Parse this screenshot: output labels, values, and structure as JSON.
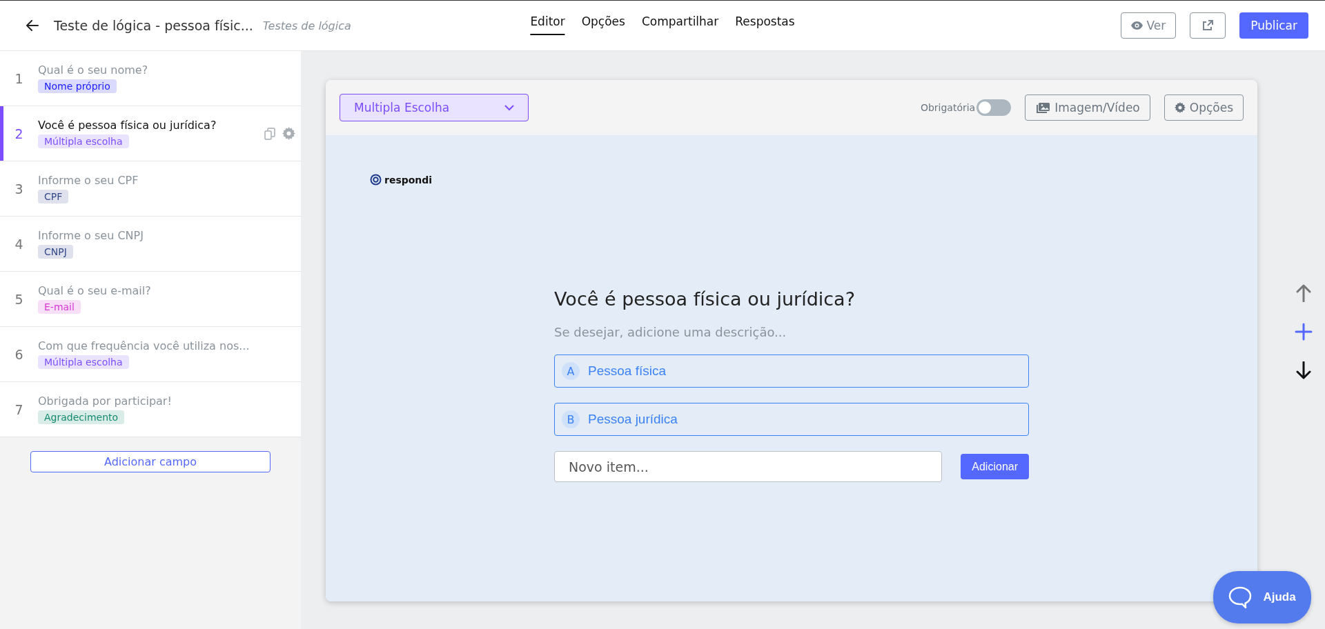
{
  "header": {
    "title": "Teste de lógica - pessoa físic...",
    "folder": "Testes de lógica",
    "tabs": [
      {
        "label": "Editor",
        "selected": true
      },
      {
        "label": "Opções",
        "selected": false
      },
      {
        "label": "Compartilhar",
        "selected": false
      },
      {
        "label": "Respostas",
        "selected": false
      }
    ],
    "view_button": "Ver",
    "publish_button": "Publicar"
  },
  "sidebar": {
    "items": [
      {
        "number": "1",
        "title": "Qual é o seu nome?",
        "tag": "Nome próprio",
        "color": "#1a1aff",
        "selected": false
      },
      {
        "number": "2",
        "title": "Você é pessoa física ou jurídica?",
        "tag": "Múltipla escolha",
        "color": "#7c4dff",
        "selected": true
      },
      {
        "number": "3",
        "title": "Informe o seu CPF",
        "tag": "CPF",
        "color": "#34488a",
        "selected": false
      },
      {
        "number": "4",
        "title": "Informe o seu CNPJ",
        "tag": "CNPJ",
        "color": "#34488a",
        "selected": false
      },
      {
        "number": "5",
        "title": "Qual é o seu e-mail?",
        "tag": "E-mail",
        "color": "#d63ad6",
        "selected": false
      },
      {
        "number": "6",
        "title": "Com que frequência você utiliza nos...",
        "tag": "Múltipla escolha",
        "color": "#7c4dff",
        "selected": false
      },
      {
        "number": "7",
        "title": "Obrigada por participar!",
        "tag": "Agradecimento",
        "color": "#138a70",
        "selected": false
      }
    ],
    "add_button": "Adicionar campo"
  },
  "editor": {
    "type_select": "Multipla Escolha",
    "required": {
      "label": "Obrigatória",
      "on": false
    },
    "media_button": "Imagem/Vídeo",
    "options_button": "Opções",
    "logo": "respondi",
    "question": "Você é pessoa física ou jurídica?",
    "description_placeholder": "Se desejar, adicione uma descrição...",
    "choices": [
      {
        "letter": "A",
        "label": "Pessoa física"
      },
      {
        "letter": "B",
        "label": "Pessoa jurídica"
      }
    ],
    "new_item_placeholder": "Novo item...",
    "add_button": "Adicionar"
  },
  "help_button": "Ajuda"
}
